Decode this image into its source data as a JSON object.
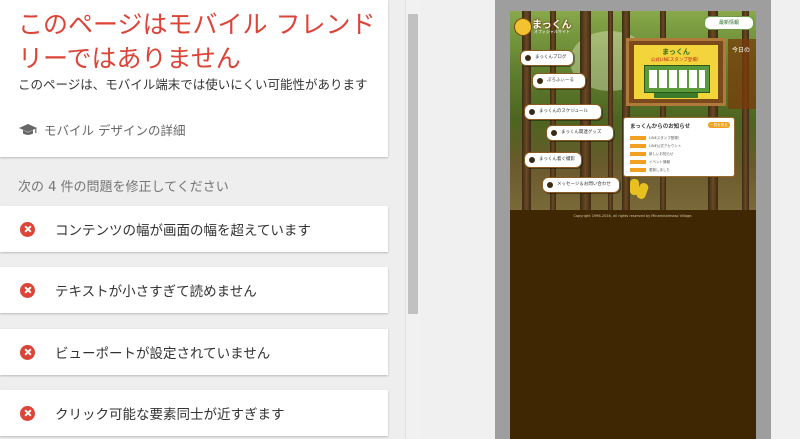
{
  "result": {
    "headline": "このページはモバイル フレンドリーではありません",
    "subtext": "このページは、モバイル端末では使いにくい可能性があります",
    "learn_more": "モバイル デザインの詳細",
    "learn_icon": "graduation-cap-icon"
  },
  "issues": {
    "title": "次の 4 件の問題を修正してください",
    "items": [
      {
        "label": "コンテンツの幅が画面の幅を超えています"
      },
      {
        "label": "テキストが小さすぎて読めません"
      },
      {
        "label": "ビューポートが設定されていません"
      },
      {
        "label": "クリック可能な要素同士が近すぎます"
      }
    ],
    "error_icon": "error-x-icon",
    "error_color": "#db4437"
  },
  "preview": {
    "site_title": "まっくん",
    "site_subtitle": "オフィシャルサイト",
    "top_button": "最新情報",
    "side_text": "今日の",
    "menu": [
      {
        "label": "まっくんブログ"
      },
      {
        "label": "ぷろふぃーる"
      },
      {
        "label": "まっくんのスケジュール"
      },
      {
        "label": "まっくん関連グッズ"
      },
      {
        "label": "まっくん着ぐ撮影"
      },
      {
        "label": "メッセージ＆お問い合わせ"
      }
    ],
    "board_title": "まっくん",
    "board_sub": "公式LINEスタンプ登場！",
    "news_title": "まっくんからのお知らせ",
    "news_button": "一覧を見る",
    "news_rows": [
      "LINEスタンプ登場！",
      "LINE公式アカウント",
      "新しいお知らせ",
      "イベント情報",
      "更新しました"
    ],
    "copyright": "Copyright 1996-2016, all rights reserved by Minamishimaso Village."
  }
}
